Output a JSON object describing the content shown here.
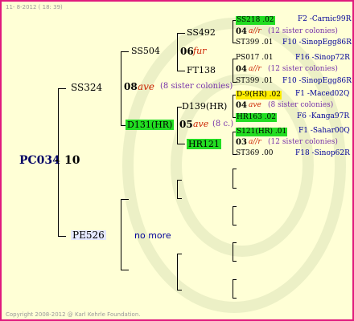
{
  "header": {
    "date": "11-  8-2012 ( 18: 39)"
  },
  "footer": {
    "copyright": "Copyright 2008-2012 @ Karl Kehrle Foundation."
  },
  "root": {
    "id": "PC034",
    "sep": "-",
    "gen": "10"
  },
  "gen1": {
    "sire": {
      "id": "SS324"
    },
    "dam": {
      "id": "PE526",
      "note": "no more"
    }
  },
  "gen2": {
    "sire": {
      "id": "SS504",
      "gen": "08",
      "tag": "ave",
      "sisters": "(8 sister colonies)"
    },
    "dam": {
      "id": "D131(HR)",
      "gen": "05",
      "tag": "ave",
      "sisters": "(8 c.)"
    }
  },
  "gen3": {
    "a": {
      "id": "SS492",
      "gen": "06",
      "tag": "fur"
    },
    "b": {
      "id": "FT138"
    },
    "c": {
      "id": "D139(HR)"
    },
    "d": {
      "id": "HR121"
    }
  },
  "gen4": [
    {
      "id": "SS218 .02",
      "code": "F2 -Carnic99R"
    },
    {
      "gen": "04",
      "tag": "a//r",
      "sisters": "(12 sister colonies)"
    },
    {
      "id": "ST399 .01",
      "code": "F10 -SinopEgg86R"
    },
    {
      "id": "PS017 .01",
      "code": "F16 -Sinop72R"
    },
    {
      "gen": "04",
      "tag": "a//r",
      "sisters": "(12 sister colonies)"
    },
    {
      "id": "ST399 .01",
      "code": "F10 -SinopEgg86R"
    },
    {
      "id": "D-9(HR) .02",
      "code": "F1 -Maced02Q"
    },
    {
      "gen": "04",
      "tag": "ave",
      "sisters": "(8 sister colonies)"
    },
    {
      "id": "HR163 .02",
      "code": "F6 -Kanga97R"
    },
    {
      "id": "S121(HR) .01",
      "code": "F1 -Sahar00Q"
    },
    {
      "gen": "03",
      "tag": "a//r",
      "sisters": "(12 sister colonies)"
    },
    {
      "id": "ST369 .00",
      "code": "F18 -Sinop62R"
    }
  ],
  "colors": {
    "border": "#e0197e",
    "background": "#ffffd6",
    "green_highlight": "#22dd22",
    "yellow_highlight": "#ffee00",
    "code_text": "#000099",
    "tag_red": "#cc2200",
    "sisters_text": "#7733aa"
  }
}
